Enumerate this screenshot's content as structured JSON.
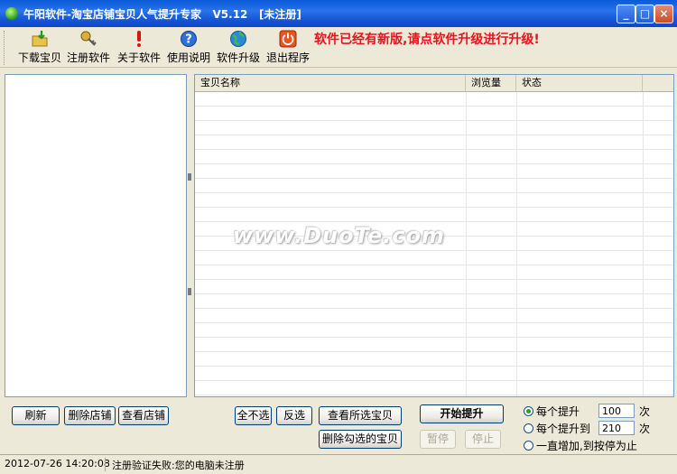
{
  "window": {
    "title": "午阳软件-淘宝店铺宝贝人气提升专家   V5.12   [未注册]",
    "min": "_",
    "max": "□",
    "close": "×"
  },
  "toolbar": {
    "items": [
      {
        "label": "下载宝贝",
        "icon": "download-icon"
      },
      {
        "label": "注册软件",
        "icon": "key-icon"
      },
      {
        "label": "关于软件",
        "icon": "exclamation-icon"
      },
      {
        "label": "使用说明",
        "icon": "help-icon"
      },
      {
        "label": "软件升级",
        "icon": "globe-icon"
      },
      {
        "label": "退出程序",
        "icon": "power-icon"
      }
    ],
    "update_message": "软件已经有新版,请点软件升级进行升级!"
  },
  "grid": {
    "columns": [
      "宝贝名称",
      "浏览量",
      "状态"
    ]
  },
  "watermark": "www.DuoTe.com",
  "buttons": {
    "refresh": "刷新",
    "delete_shop": "删除店铺",
    "view_shop": "查看店铺",
    "unselect_all": "全不选",
    "invert": "反选",
    "view_selected": "查看所选宝贝",
    "delete_checked": "删除勾选的宝贝",
    "start": "开始提升",
    "pause": "暂停",
    "stop": "停止"
  },
  "options": {
    "each_boost": {
      "label": "每个提升",
      "value": "100",
      "unit": "次",
      "selected": true
    },
    "boost_to": {
      "label": "每个提升到",
      "value": "210",
      "unit": "次",
      "selected": false
    },
    "until_stop": {
      "label": "一直增加,到按停为止",
      "selected": false
    }
  },
  "status": {
    "time": "2012-07-26 14:20:08",
    "message": "注册验证失败:您的电脑未注册"
  },
  "colors": {
    "update_message": "#e8131c",
    "titlebar": "#1658d6"
  }
}
